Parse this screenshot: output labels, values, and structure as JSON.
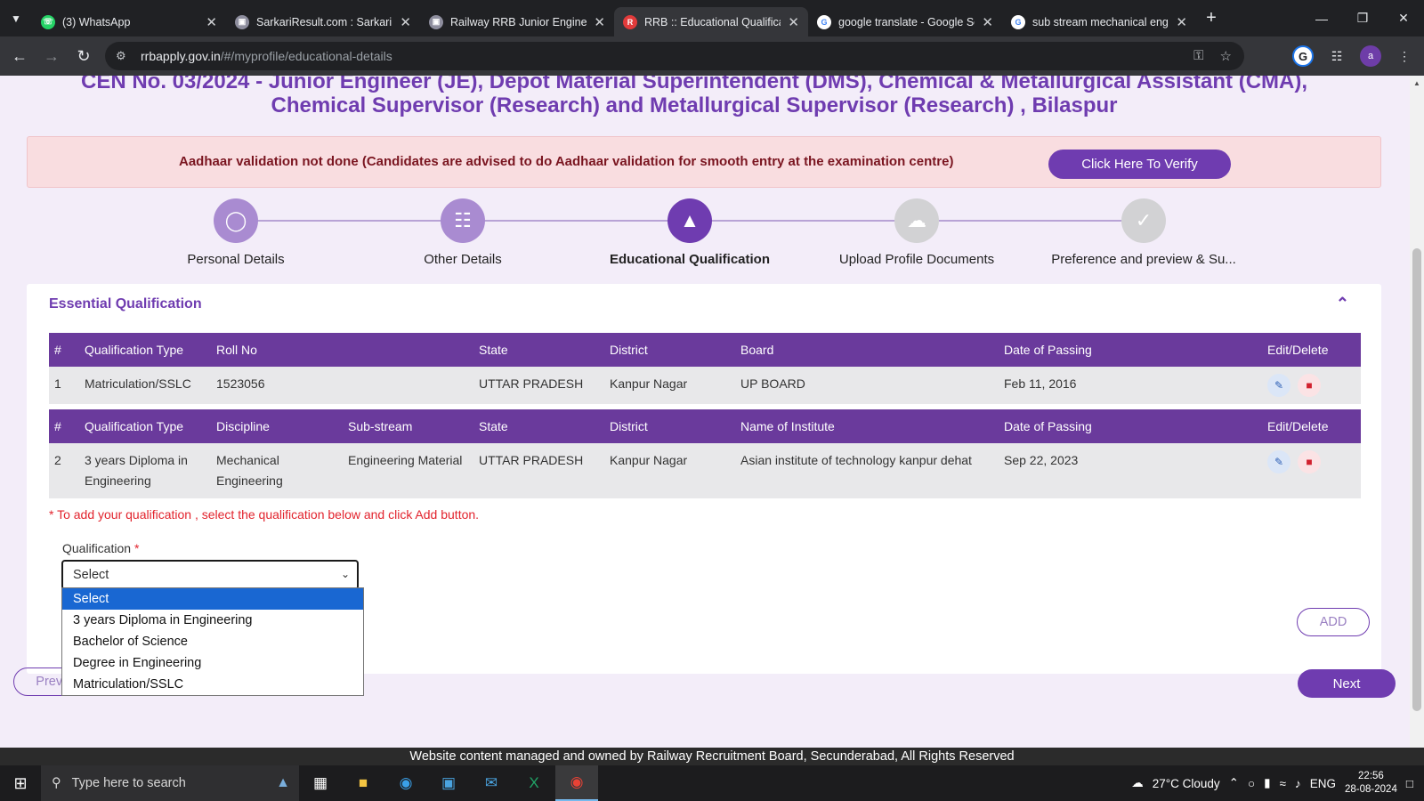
{
  "browser": {
    "tabs": [
      {
        "title": "(3) WhatsApp",
        "icon": "whatsapp-icon",
        "active": false
      },
      {
        "title": "SarkariResult.com : Sarkari Re",
        "icon": "page-icon",
        "active": false
      },
      {
        "title": "Railway RRB Junior Engineer",
        "icon": "page-icon",
        "active": false
      },
      {
        "title": "RRB :: Educational Qualificati",
        "icon": "rrb-icon",
        "active": true
      },
      {
        "title": "google translate - Google Se",
        "icon": "google-icon",
        "active": false
      },
      {
        "title": "sub stream mechanical engi",
        "icon": "google-icon",
        "active": false
      }
    ],
    "url_host": "rrbapply.gov.in",
    "url_path": "/#/myprofile/educational-details",
    "profile_initial": "a"
  },
  "page": {
    "title_line1": "CEN No. 03/2024 - Junior Engineer (JE), Depot Material Superintendent (DMS), Chemical & Metallurgical Assistant (CMA),",
    "title_line2": "Chemical Supervisor (Research) and Metallurgical Supervisor (Research) , Bilaspur",
    "alert": {
      "message": "Aadhaar validation not done (Candidates are advised to do Aadhaar validation for smooth entry at the examination centre)",
      "button": "Click Here To Verify"
    },
    "steps": [
      {
        "label": "Personal Details",
        "icon": "person-icon",
        "state": "done"
      },
      {
        "label": "Other Details",
        "icon": "id-card-icon",
        "state": "done"
      },
      {
        "label": "Educational Qualification",
        "icon": "graduation-cap-icon",
        "state": "current"
      },
      {
        "label": "Upload Profile Documents",
        "icon": "cloud-upload-icon",
        "state": "pending"
      },
      {
        "label": "Preference and preview & Su...",
        "icon": "clipboard-check-icon",
        "state": "pending"
      }
    ],
    "section_title": "Essential Qualification",
    "table1": {
      "headers": [
        "#",
        "Qualification Type",
        "Roll No",
        "State",
        "District",
        "Board",
        "Date of Passing",
        "Edit/Delete"
      ],
      "rows": [
        [
          "1",
          "Matriculation/SSLC",
          "1523056",
          "UTTAR PRADESH",
          "Kanpur Nagar",
          "UP BOARD",
          "Feb 11, 2016"
        ]
      ]
    },
    "table2": {
      "headers": [
        "#",
        "Qualification Type",
        "Discipline",
        "Sub-stream",
        "State",
        "District",
        "Name of Institute",
        "Date of Passing",
        "Edit/Delete"
      ],
      "rows": [
        [
          "2",
          "3 years Diploma in Engineering",
          "Mechanical Engineering",
          "Engineering Material",
          "UTTAR PRADESH",
          "Kanpur Nagar",
          "Asian institute of technology kanpur dehat",
          "Sep 22, 2023"
        ]
      ]
    },
    "note": "* To add your qualification , select the qualification below and click Add button.",
    "qualification_label": "Qualification",
    "required_mark": "*",
    "select_value": "Select",
    "dropdown_options": [
      "Select",
      "3 years Diploma in Engineering",
      "Bachelor of Science",
      "Degree in Engineering",
      "Matriculation/SSLC"
    ],
    "add_button": "ADD",
    "prev_button": "Previous",
    "next_button": "Next",
    "footer": "Website content managed and owned by Railway Recruitment Board, Secunderabad, All Rights Reserved"
  },
  "taskbar": {
    "search_placeholder": "Type here to search",
    "weather": "27°C  Cloudy",
    "lang": "ENG",
    "time": "22:56",
    "date": "28-08-2024"
  },
  "colors": {
    "accent": "#6f3cb0",
    "table_header": "#6a3a9c",
    "alert_bg": "#f9dde0",
    "error": "#e2232d"
  }
}
